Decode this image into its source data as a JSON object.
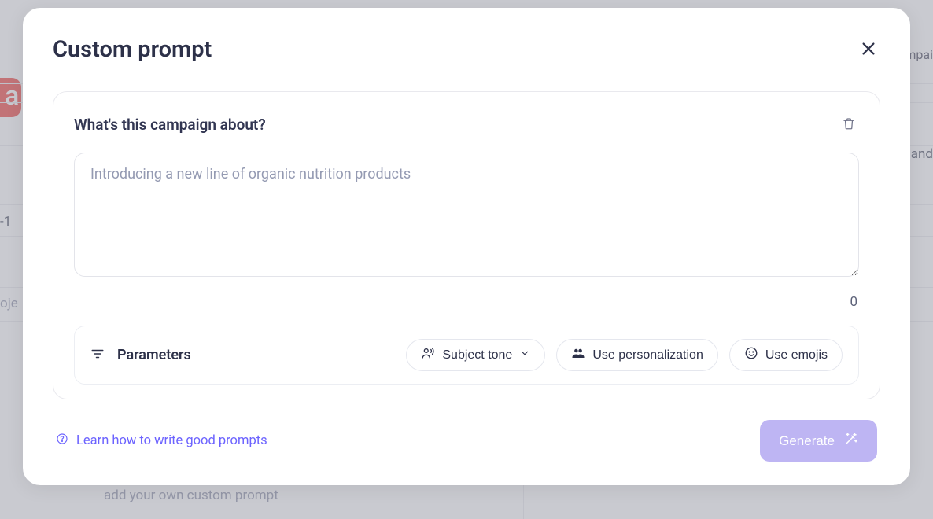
{
  "modal": {
    "title": "Custom prompt",
    "section_title": "What's this campaign about?",
    "placeholder": "Introducing a new line of organic nutrition products",
    "counter": "0",
    "parameters_label": "Parameters",
    "pills": {
      "subject_tone": "Subject tone",
      "personalization": "Use personalization",
      "emojis": "Use emojis"
    },
    "learn_link": "Learn how to write good prompts",
    "generate": "Generate"
  },
  "background": {
    "logo_letter": "a",
    "frag_campaign": "ampai",
    "frag_nt_and": "nt and",
    "frag_dash1": "-1",
    "frag_oje": "oje",
    "frag_custom_prompt": "add your own custom prompt"
  }
}
